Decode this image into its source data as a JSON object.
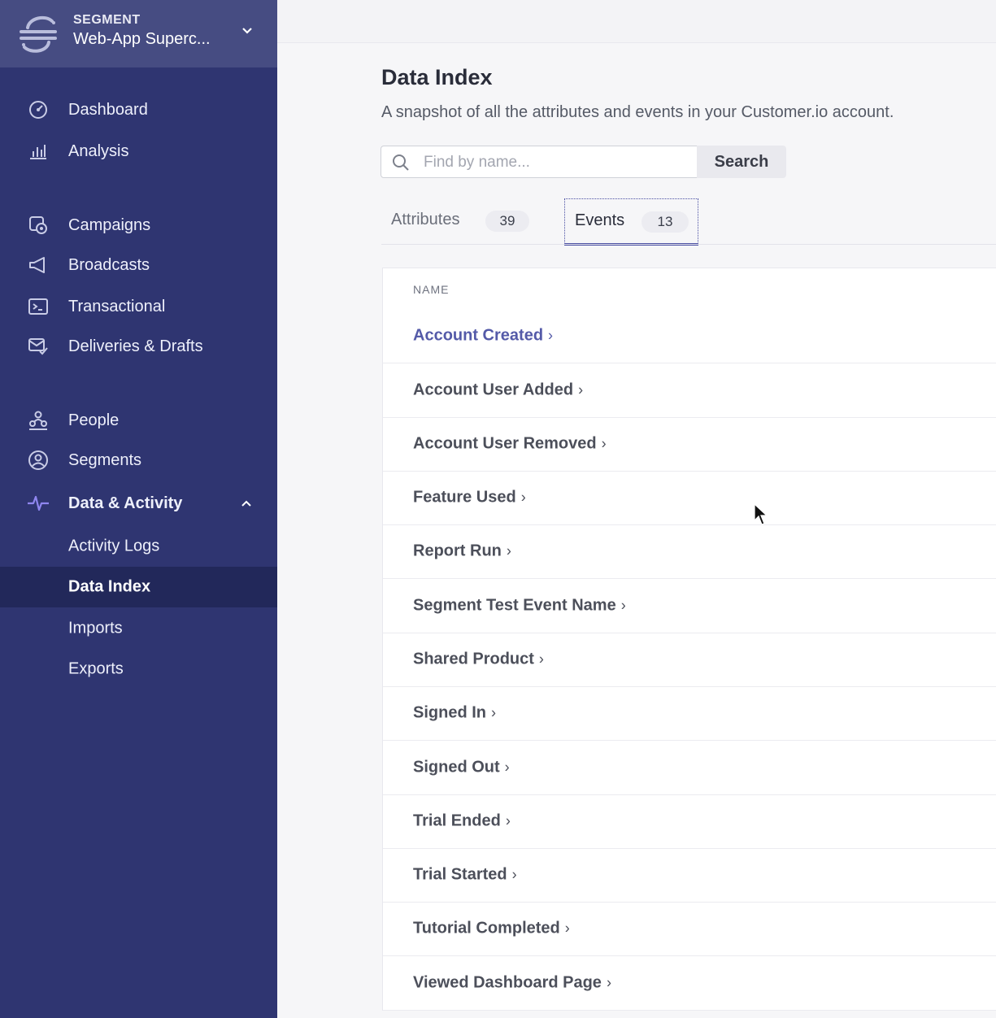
{
  "workspace": {
    "brand": "SEGMENT",
    "name": "Web-App Superc..."
  },
  "nav": {
    "dashboard": "Dashboard",
    "analysis": "Analysis",
    "campaigns": "Campaigns",
    "broadcasts": "Broadcasts",
    "transactional": "Transactional",
    "deliveries": "Deliveries & Drafts",
    "people": "People",
    "segments": "Segments",
    "data_activity": "Data & Activity",
    "activity_logs": "Activity Logs",
    "data_index": "Data Index",
    "imports": "Imports",
    "exports": "Exports"
  },
  "page": {
    "title": "Data Index",
    "subtitle": "A snapshot of all the attributes and events in your Customer.io account."
  },
  "search": {
    "placeholder": "Find by name...",
    "button": "Search"
  },
  "tabs": [
    {
      "label": "Attributes",
      "count": "39"
    },
    {
      "label": "Events",
      "count": "13"
    }
  ],
  "table": {
    "header": "NAME",
    "rows": [
      "Account Created",
      "Account User Added",
      "Account User Removed",
      "Feature Used",
      "Report Run",
      "Segment Test Event Name",
      "Shared Product",
      "Signed In",
      "Signed Out",
      "Trial Ended",
      "Trial Started",
      "Tutorial Completed",
      "Viewed Dashboard Page"
    ]
  },
  "colors": {
    "sidebar": "#2f3571",
    "sidebar_active": "#22285a",
    "accent": "#4a4fa3",
    "link": "#545aa8"
  },
  "icons": {
    "brand": "segment-logo-icon",
    "dashboard": "gauge-icon",
    "analysis": "bar-chart-icon",
    "campaigns": "campaigns-icon",
    "broadcasts": "megaphone-icon",
    "transactional": "terminal-icon",
    "deliveries": "deliveries-icon",
    "people": "people-icon",
    "segments": "segments-icon",
    "data_activity": "pulse-icon",
    "search": "search-icon"
  }
}
